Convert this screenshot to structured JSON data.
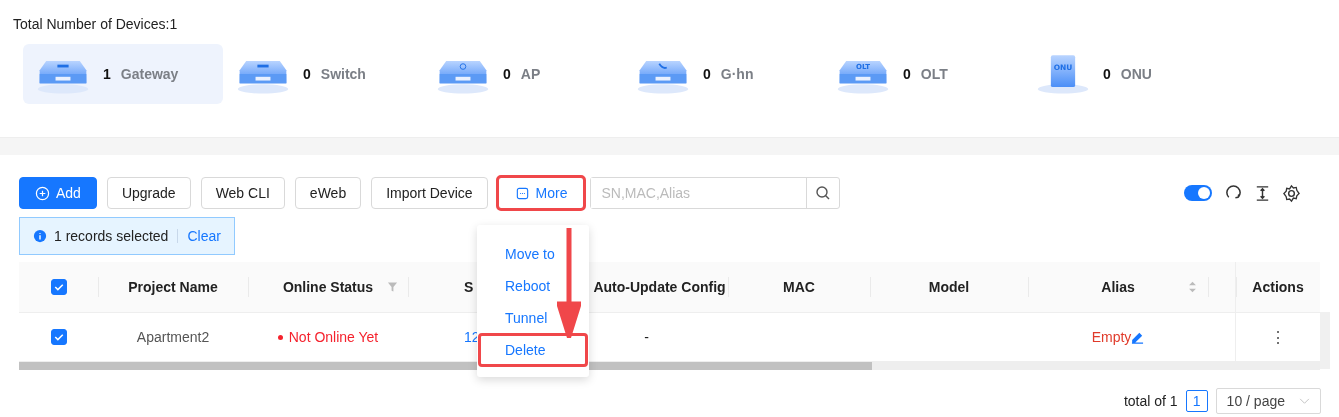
{
  "summary": {
    "label": "Total Number of Devices:1"
  },
  "device_types": [
    {
      "kind": "gateway",
      "count": "1",
      "label": "Gateway",
      "selected": true
    },
    {
      "kind": "switch",
      "count": "0",
      "label": "Switch",
      "selected": false
    },
    {
      "kind": "ap",
      "count": "0",
      "label": "AP",
      "selected": false
    },
    {
      "kind": "ghn",
      "count": "0",
      "label": "G·hn",
      "selected": false
    },
    {
      "kind": "olt",
      "count": "0",
      "label": "OLT",
      "selected": false,
      "badge": "OLT"
    },
    {
      "kind": "onu",
      "count": "0",
      "label": "ONU",
      "selected": false,
      "badge": "ONU"
    }
  ],
  "toolbar": {
    "buttons": [
      {
        "kind": "primary",
        "label": "Add",
        "annotated": false
      },
      {
        "kind": "default",
        "label": "Upgrade",
        "annotated": false
      },
      {
        "kind": "default",
        "label": "Web CLI",
        "annotated": false
      },
      {
        "kind": "default",
        "label": "eWeb",
        "annotated": false
      },
      {
        "kind": "default",
        "label": "Import Device",
        "annotated": false
      },
      {
        "kind": "menu",
        "label": "More",
        "annotated": true
      }
    ],
    "search": {
      "placeholder": "SN,MAC,Alias"
    },
    "toggle": {
      "on": true
    }
  },
  "selection_info": {
    "text": "1 records selected",
    "action": "Clear"
  },
  "more_menu": {
    "items": [
      {
        "label": "Move to",
        "annotated": false
      },
      {
        "label": "Reboot",
        "annotated": false
      },
      {
        "label": "Tunnel",
        "annotated": false
      },
      {
        "label": "Delete",
        "annotated": true
      }
    ]
  },
  "table": {
    "select_all": {
      "checked": true
    },
    "columns": [
      {
        "label": "Project Name",
        "kind": "plain"
      },
      {
        "label": "Online Status",
        "kind": "filterable"
      },
      {
        "label": "S",
        "kind": "plain"
      },
      {
        "label": "Auto-Update Config",
        "kind": "plain"
      },
      {
        "label": "MAC",
        "kind": "plain"
      },
      {
        "label": "Model",
        "kind": "plain"
      },
      {
        "label": "Alias",
        "kind": "sortable"
      },
      {
        "label": "Actions",
        "kind": "plain"
      }
    ],
    "rows": [
      {
        "checked": true,
        "project": "Apartment2",
        "status": "Not Online Yet",
        "sn": "12",
        "auto_update": "-",
        "alias": "Empty",
        "actions": "⋮"
      }
    ]
  },
  "pagination": {
    "total": "total of 1",
    "pages": [
      {
        "label": "1",
        "selected": true
      }
    ],
    "page_size": "10 / page"
  }
}
